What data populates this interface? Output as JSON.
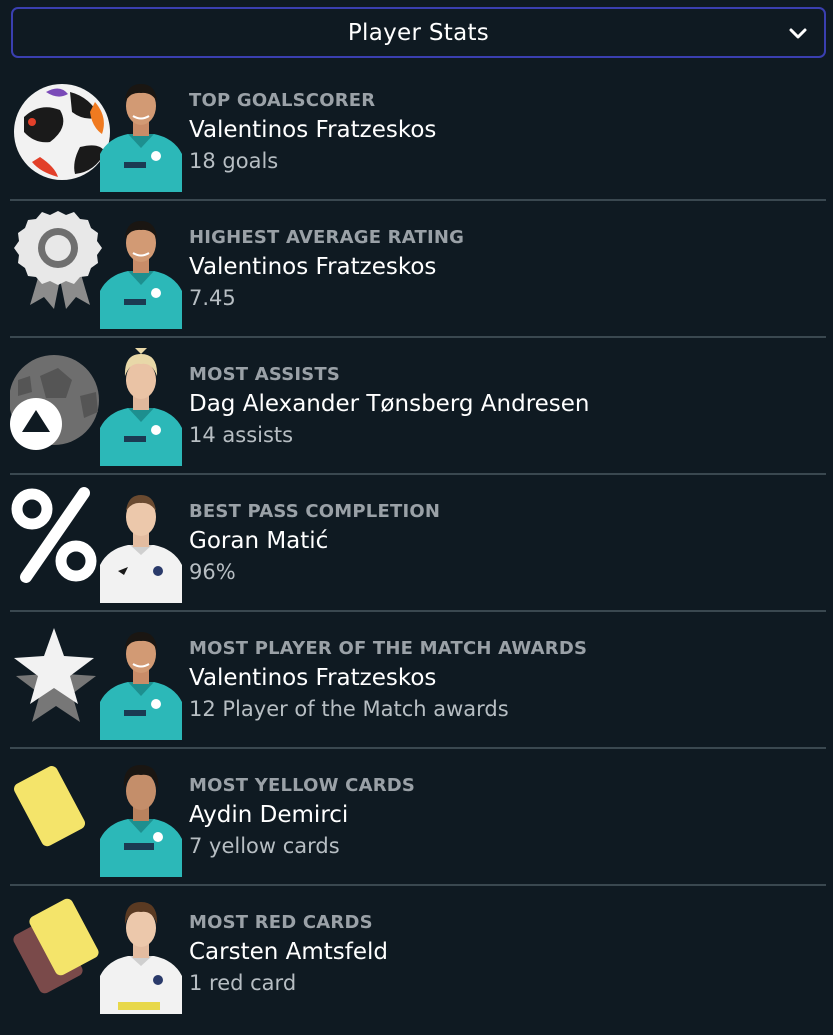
{
  "header": {
    "dropdown_label": "Player Stats",
    "dropdown_icon": "chevron-down-icon"
  },
  "colors": {
    "background": "#0f1a22",
    "dropdown_border": "#3a3fb0",
    "category_text": "#9aa1a7",
    "value_text": "#b7bec3",
    "kit_teal": "#2cb8b8",
    "kit_white": "#f2f2f2",
    "yellow_card": "#f4e46a",
    "red_card": "#7a4a4a"
  },
  "stats": [
    {
      "category": "TOP GOALSCORER",
      "player": "Valentinos Fratzeskos",
      "value": "18 goals",
      "icon": "football-icon",
      "kit": "teal"
    },
    {
      "category": "HIGHEST AVERAGE RATING",
      "player": "Valentinos Fratzeskos",
      "value": "7.45",
      "icon": "rosette-icon",
      "kit": "teal"
    },
    {
      "category": "MOST ASSISTS",
      "player": "Dag Alexander Tønsberg Andresen",
      "value": "14 assists",
      "icon": "assist-ball-icon",
      "kit": "teal"
    },
    {
      "category": "BEST PASS COMPLETION",
      "player": "Goran Matić",
      "value": "96%",
      "icon": "percent-icon",
      "kit": "white"
    },
    {
      "category": "MOST PLAYER OF THE MATCH AWARDS",
      "player": "Valentinos Fratzeskos",
      "value": "12 Player of the Match awards",
      "icon": "star-icon",
      "kit": "teal"
    },
    {
      "category": "MOST YELLOW CARDS",
      "player": "Aydin Demirci",
      "value": "7 yellow cards",
      "icon": "yellow-card-icon",
      "kit": "teal"
    },
    {
      "category": "MOST RED CARDS",
      "player": "Carsten Amtsfeld",
      "value": "1 red card",
      "icon": "red-card-icon",
      "kit": "white"
    }
  ]
}
